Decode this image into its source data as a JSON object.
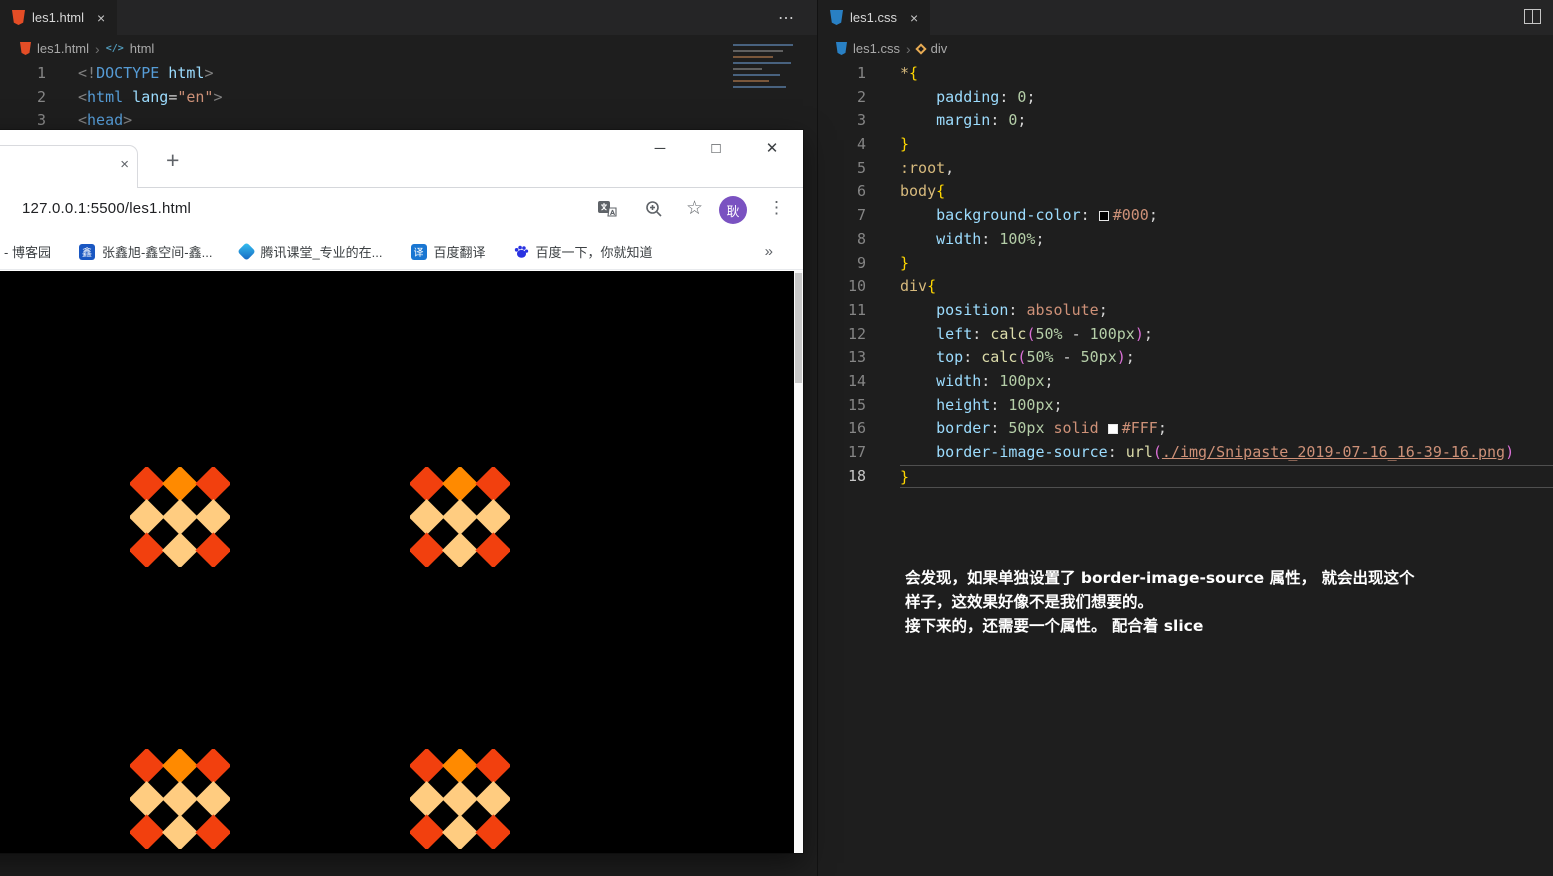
{
  "app": {
    "left": {
      "tab": {
        "label": "les1.html",
        "close": "×"
      },
      "more_actions": "⋯",
      "breadcrumb": {
        "file": "les1.html",
        "sep": "›",
        "symbol": "html"
      },
      "code": {
        "lines": [
          {
            "n": "1",
            "tokens": [
              [
                "<!",
                "grey"
              ],
              [
                "DOCTYPE",
                "tag"
              ],
              [
                " html",
                "attr"
              ],
              [
                ">",
                "grey"
              ]
            ]
          },
          {
            "n": "2",
            "tokens": [
              [
                "<",
                "grey"
              ],
              [
                "html",
                "tag"
              ],
              [
                " lang",
                "attr"
              ],
              [
                "=",
                "pn"
              ],
              [
                "\"en\"",
                "str"
              ],
              [
                ">",
                "grey"
              ]
            ]
          },
          {
            "n": "3",
            "tokens": [
              [
                "<",
                "grey"
              ],
              [
                "head",
                "tag"
              ],
              [
                ">",
                "grey"
              ]
            ]
          }
        ]
      }
    },
    "right": {
      "tab": {
        "label": "les1.css",
        "close": "×"
      },
      "breadcrumb": {
        "file": "les1.css",
        "sep": "›",
        "symbol": "div"
      },
      "code": {
        "lines": [
          {
            "n": "1",
            "tokens": [
              [
                "*",
                "sel"
              ],
              [
                "{",
                "brace"
              ]
            ]
          },
          {
            "n": "2",
            "tokens": [
              [
                "    ",
                "pn"
              ],
              [
                "padding",
                "prop"
              ],
              [
                ": ",
                "pn"
              ],
              [
                "0",
                "num"
              ],
              [
                ";",
                "pn"
              ]
            ]
          },
          {
            "n": "3",
            "tokens": [
              [
                "    ",
                "pn"
              ],
              [
                "margin",
                "prop"
              ],
              [
                ": ",
                "pn"
              ],
              [
                "0",
                "num"
              ],
              [
                ";",
                "pn"
              ]
            ]
          },
          {
            "n": "4",
            "tokens": [
              [
                "}",
                "brace"
              ]
            ]
          },
          {
            "n": "5",
            "tokens": [
              [
                ":root",
                "sel"
              ],
              [
                ",",
                "pn"
              ]
            ]
          },
          {
            "n": "6",
            "tokens": [
              [
                "body",
                "sel"
              ],
              [
                "{",
                "brace"
              ]
            ]
          },
          {
            "n": "7",
            "tokens": [
              [
                "    ",
                "pn"
              ],
              [
                "background-color",
                "prop"
              ],
              [
                ": ",
                "pn"
              ],
              [
                "",
                "swatch-b"
              ],
              [
                "#000",
                "val"
              ],
              [
                ";",
                "pn"
              ]
            ]
          },
          {
            "n": "8",
            "tokens": [
              [
                "    ",
                "pn"
              ],
              [
                "width",
                "prop"
              ],
              [
                ": ",
                "pn"
              ],
              [
                "100%",
                "num"
              ],
              [
                ";",
                "pn"
              ]
            ]
          },
          {
            "n": "9",
            "tokens": [
              [
                "}",
                "brace"
              ]
            ]
          },
          {
            "n": "10",
            "tokens": [
              [
                "div",
                "sel"
              ],
              [
                "{",
                "brace"
              ]
            ]
          },
          {
            "n": "11",
            "tokens": [
              [
                "    ",
                "pn"
              ],
              [
                "position",
                "prop"
              ],
              [
                ": ",
                "pn"
              ],
              [
                "absolute",
                "val"
              ],
              [
                ";",
                "pn"
              ]
            ]
          },
          {
            "n": "12",
            "tokens": [
              [
                "    ",
                "pn"
              ],
              [
                "left",
                "prop"
              ],
              [
                ": ",
                "pn"
              ],
              [
                "calc",
                "fn"
              ],
              [
                "(",
                "paren"
              ],
              [
                "50%",
                "num"
              ],
              [
                " - ",
                "pn"
              ],
              [
                "100px",
                "num"
              ],
              [
                ")",
                "paren"
              ],
              [
                ";",
                "pn"
              ]
            ]
          },
          {
            "n": "13",
            "tokens": [
              [
                "    ",
                "pn"
              ],
              [
                "top",
                "prop"
              ],
              [
                ": ",
                "pn"
              ],
              [
                "calc",
                "fn"
              ],
              [
                "(",
                "paren"
              ],
              [
                "50%",
                "num"
              ],
              [
                " - ",
                "pn"
              ],
              [
                "50px",
                "num"
              ],
              [
                ")",
                "paren"
              ],
              [
                ";",
                "pn"
              ]
            ]
          },
          {
            "n": "14",
            "tokens": [
              [
                "    ",
                "pn"
              ],
              [
                "width",
                "prop"
              ],
              [
                ": ",
                "pn"
              ],
              [
                "100px",
                "num"
              ],
              [
                ";",
                "pn"
              ]
            ]
          },
          {
            "n": "15",
            "tokens": [
              [
                "    ",
                "pn"
              ],
              [
                "height",
                "prop"
              ],
              [
                ": ",
                "pn"
              ],
              [
                "100px",
                "num"
              ],
              [
                ";",
                "pn"
              ]
            ]
          },
          {
            "n": "16",
            "tokens": [
              [
                "    ",
                "pn"
              ],
              [
                "border",
                "prop"
              ],
              [
                ": ",
                "pn"
              ],
              [
                "50px",
                "num"
              ],
              [
                " ",
                "pn"
              ],
              [
                "solid",
                "val"
              ],
              [
                " ",
                "pn"
              ],
              [
                "",
                "swatch-w"
              ],
              [
                "#FFF",
                "val"
              ],
              [
                ";",
                "pn"
              ]
            ]
          },
          {
            "n": "17",
            "tokens": [
              [
                "    ",
                "pn"
              ],
              [
                "border-image-source",
                "prop"
              ],
              [
                ": ",
                "pn"
              ],
              [
                "url",
                "fn"
              ],
              [
                "(",
                "paren"
              ],
              [
                "./img/Snipaste_2019-07-16_16-39-16.png",
                "link"
              ],
              [
                ")",
                "paren"
              ]
            ]
          },
          {
            "n": "18",
            "active": true,
            "tokens": [
              [
                "}",
                "brace"
              ]
            ]
          }
        ]
      },
      "note": {
        "lines": [
          "会发现，如果单独设置了 border-image-source 属性， 就会出现这个",
          "样子，这效果好像不是我们想要的。",
          "接下来的，还需要一个属性。 配合着 slice"
        ]
      }
    }
  },
  "browser": {
    "controls": {
      "minimize": "─",
      "maximize": "□",
      "close": "✕"
    },
    "tabstrip": {
      "tab_close": "×",
      "new_tab": "+"
    },
    "address": {
      "reload_icon": "↻",
      "url": "127.0.0.1:5500/les1.html",
      "star_icon": "☆",
      "menu_icon": "⋮"
    },
    "profile": {
      "label": "耿",
      "color": "#7a52c1"
    },
    "bookmarks": {
      "items": [
        {
          "label": "- 博客园"
        },
        {
          "icon_text": "鑫",
          "label": "张鑫旭-鑫空间-鑫..."
        },
        {
          "label": "腾讯课堂_专业的在..."
        },
        {
          "icon_text": "译",
          "label": "百度翻译"
        },
        {
          "label": "百度一下，你就知道"
        }
      ],
      "overflow": "»"
    },
    "page": {
      "bg": "#000000",
      "pattern_grid": [
        [
          "#f2400e",
          "#ff8a00",
          "#f2400e"
        ],
        [
          "#ffcc80",
          "#ffcc80",
          "#ffcc80"
        ],
        [
          "#f2400e",
          "#ffcc80",
          "#f2400e"
        ]
      ]
    }
  }
}
